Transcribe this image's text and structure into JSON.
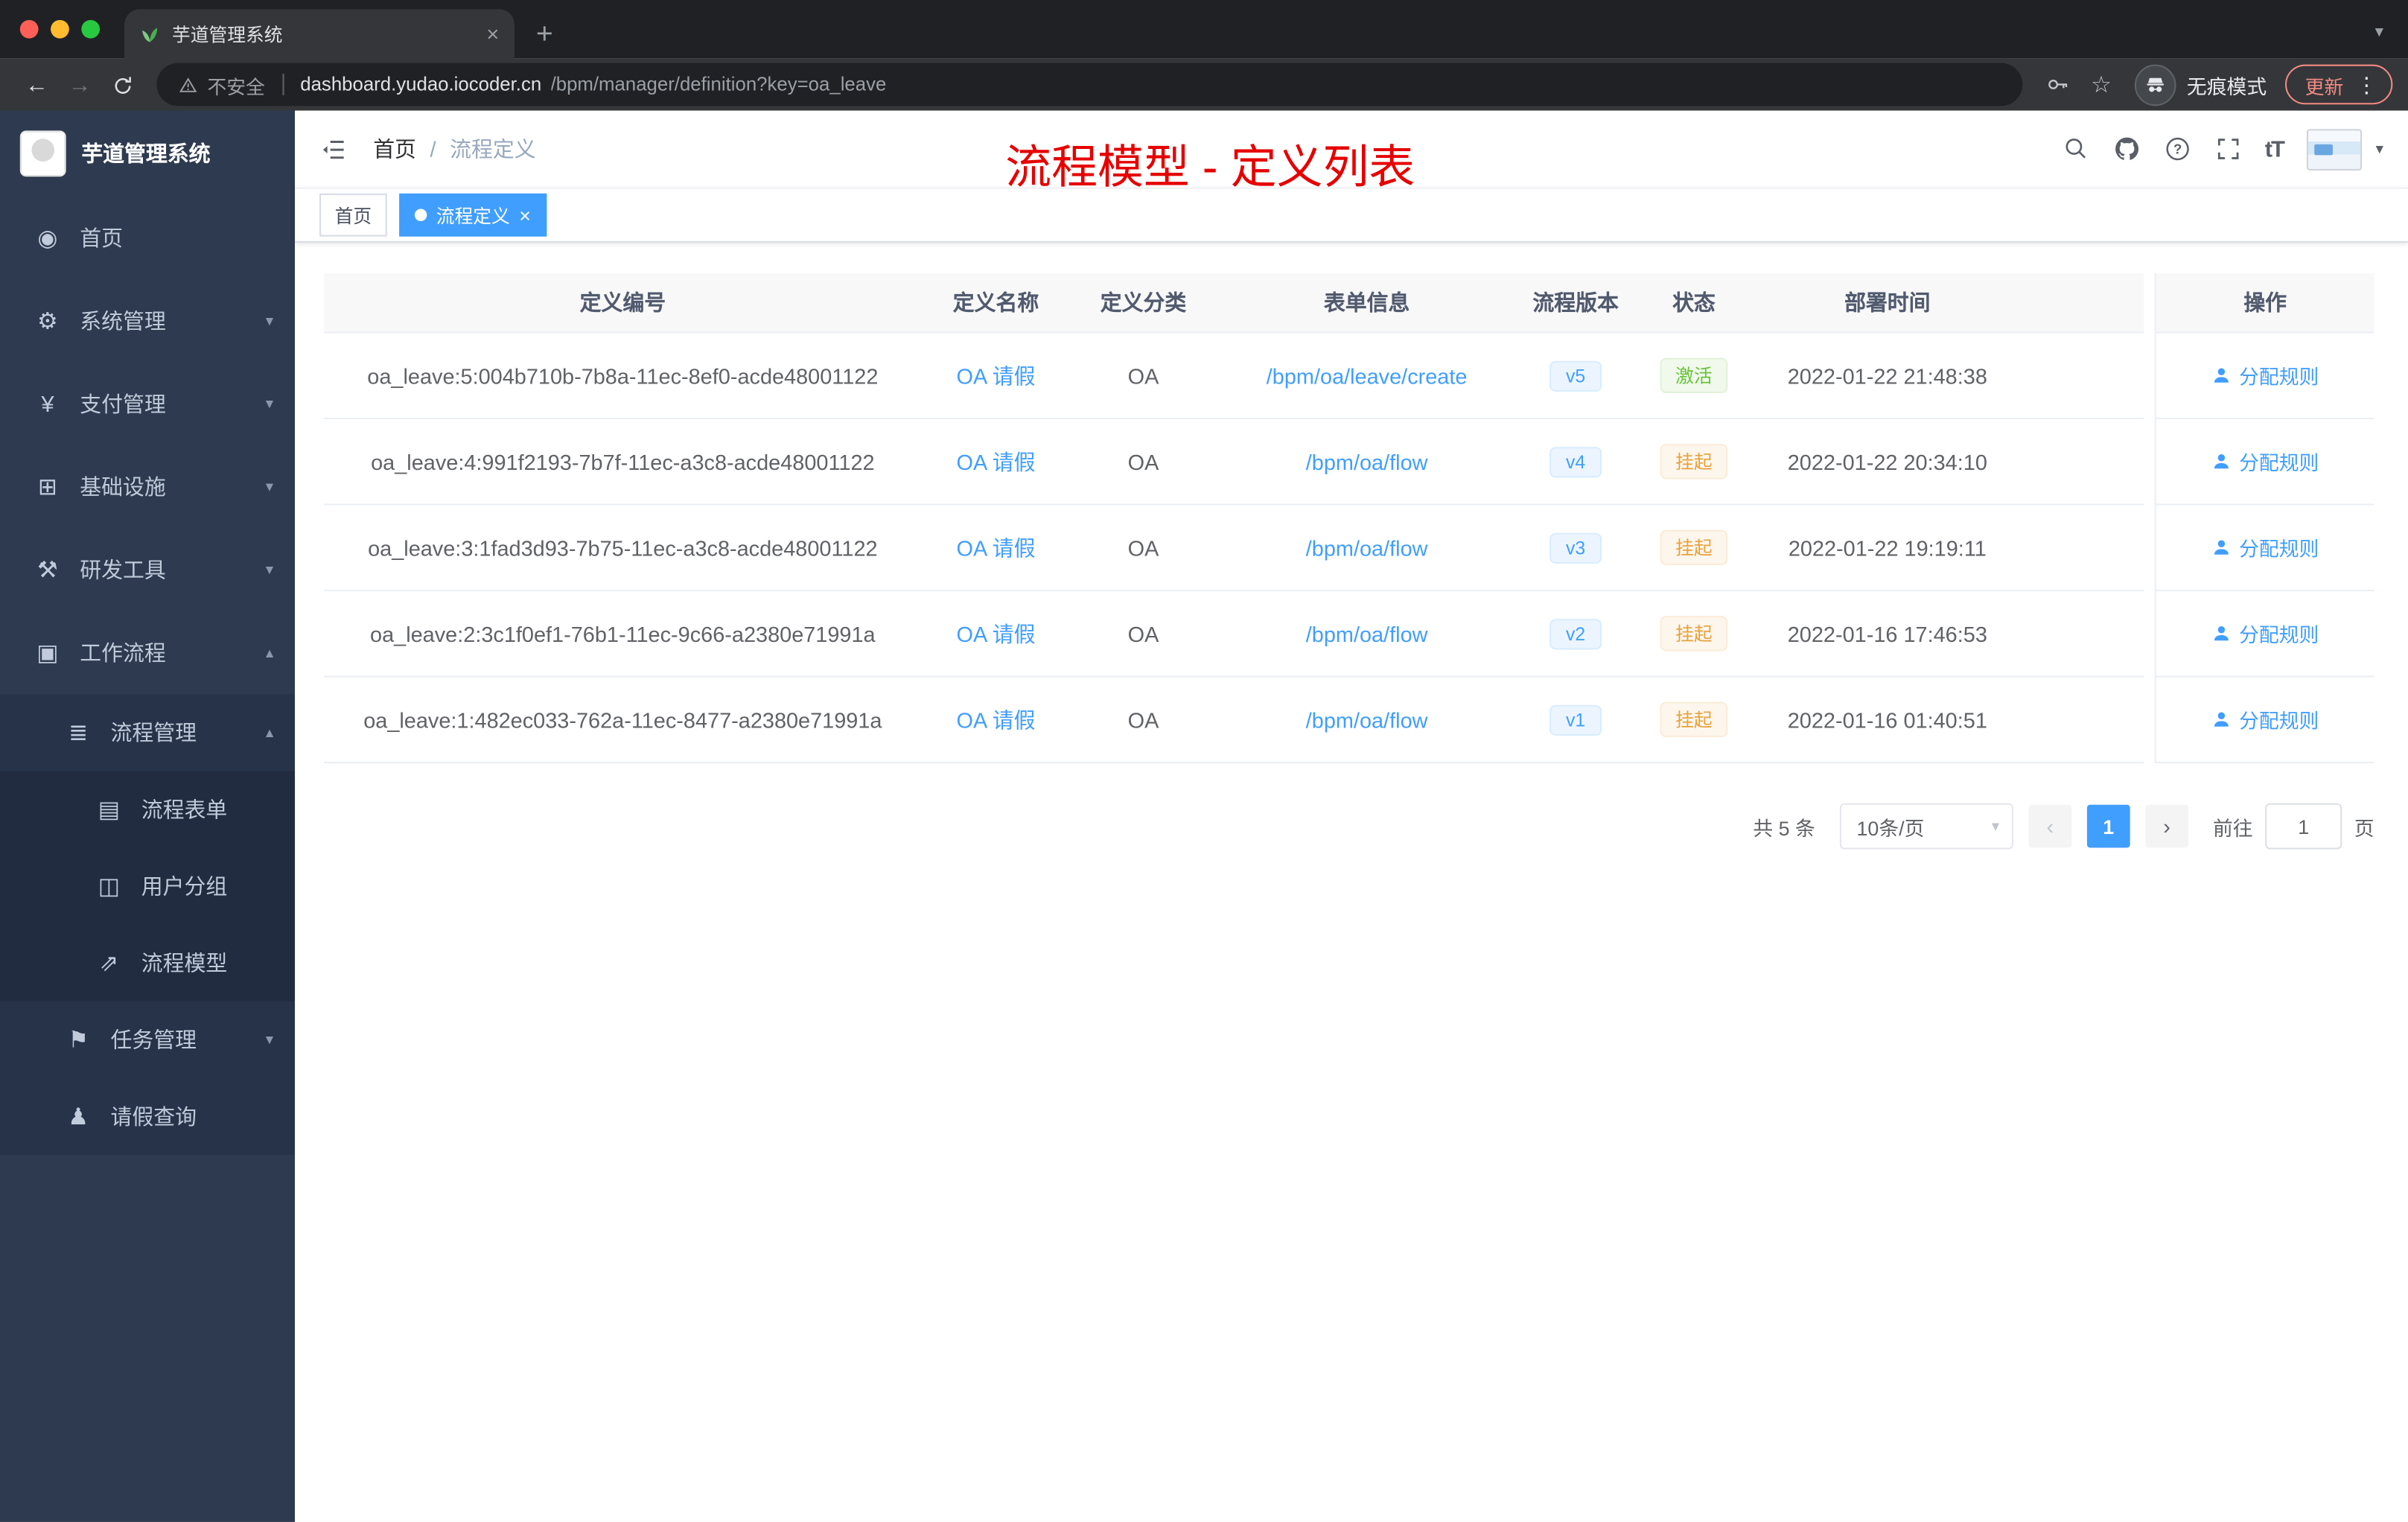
{
  "browser": {
    "tab_title": "芋道管理系统",
    "security_label": "不安全",
    "url_host": "dashboard.yudao.iocoder.cn",
    "url_path": "/bpm/manager/definition?key=oa_leave",
    "incognito_label": "无痕模式",
    "update_label": "更新"
  },
  "colors": {
    "accent": "#409eff",
    "success": "#67c23a",
    "warning": "#e6a23c",
    "annotation_red": "#e60000",
    "sidebar_bg": "#2e3a4f"
  },
  "sidebar": {
    "brand": "芋道管理系统",
    "items": [
      {
        "label": "首页",
        "icon": "dashboard-icon",
        "glyph": "◉",
        "level": "l1",
        "chevron": "none"
      },
      {
        "label": "系统管理",
        "icon": "gear-icon",
        "glyph": "⚙",
        "level": "l1",
        "chevron": "down"
      },
      {
        "label": "支付管理",
        "icon": "payment-icon",
        "glyph": "¥",
        "level": "l1",
        "chevron": "down"
      },
      {
        "label": "基础设施",
        "icon": "infrastructure-icon",
        "glyph": "⊞",
        "level": "l1",
        "chevron": "down"
      },
      {
        "label": "研发工具",
        "icon": "dev-tools-icon",
        "glyph": "⚒",
        "level": "l1",
        "chevron": "down"
      },
      {
        "label": "工作流程",
        "icon": "workflow-icon",
        "glyph": "▣",
        "level": "l1",
        "chevron": "up"
      },
      {
        "label": "流程管理",
        "icon": "process-list-icon",
        "glyph": "≣",
        "level": "l2",
        "chevron": "up"
      },
      {
        "label": "流程表单",
        "icon": "form-icon",
        "glyph": "▤",
        "level": "l3",
        "chevron": "none"
      },
      {
        "label": "用户分组",
        "icon": "user-group-icon",
        "glyph": "◫",
        "level": "l3",
        "chevron": "none"
      },
      {
        "label": "流程模型",
        "icon": "process-model-icon",
        "glyph": "⇗",
        "level": "l3",
        "chevron": "none"
      },
      {
        "label": "任务管理",
        "icon": "task-icon",
        "glyph": "⚑",
        "level": "l2",
        "chevron": "down"
      },
      {
        "label": "请假查询",
        "icon": "leave-query-icon",
        "glyph": "♟",
        "level": "l2",
        "chevron": "none"
      }
    ]
  },
  "header": {
    "breadcrumb_home": "首页",
    "breadcrumb_separator": "/",
    "breadcrumb_current": "流程定义",
    "annotation": "流程模型 - 定义列表",
    "fontsize_icon_text": "tT"
  },
  "tags": [
    {
      "label": "首页",
      "state": "plain"
    },
    {
      "label": "流程定义",
      "state": "active"
    }
  ],
  "table": {
    "columns": [
      "定义编号",
      "定义名称",
      "定义分类",
      "表单信息",
      "流程版本",
      "状态",
      "部署时间",
      "操作"
    ],
    "action_label": "分配规则",
    "rows": [
      {
        "id": "oa_leave:5:004b710b-7b8a-11ec-8ef0-acde48001122",
        "name": "OA 请假",
        "category": "OA",
        "form": "/bpm/oa/leave/create",
        "version": "v5",
        "status": "激活",
        "status_type": "success",
        "deploy_time": "2022-01-22 21:48:38"
      },
      {
        "id": "oa_leave:4:991f2193-7b7f-11ec-a3c8-acde48001122",
        "name": "OA 请假",
        "category": "OA",
        "form": "/bpm/oa/flow",
        "version": "v4",
        "status": "挂起",
        "status_type": "warning",
        "deploy_time": "2022-01-22 20:34:10"
      },
      {
        "id": "oa_leave:3:1fad3d93-7b75-11ec-a3c8-acde48001122",
        "name": "OA 请假",
        "category": "OA",
        "form": "/bpm/oa/flow",
        "version": "v3",
        "status": "挂起",
        "status_type": "warning",
        "deploy_time": "2022-01-22 19:19:11"
      },
      {
        "id": "oa_leave:2:3c1f0ef1-76b1-11ec-9c66-a2380e71991a",
        "name": "OA 请假",
        "category": "OA",
        "form": "/bpm/oa/flow",
        "version": "v2",
        "status": "挂起",
        "status_type": "warning",
        "deploy_time": "2022-01-16 17:46:53"
      },
      {
        "id": "oa_leave:1:482ec033-762a-11ec-8477-a2380e71991a",
        "name": "OA 请假",
        "category": "OA",
        "form": "/bpm/oa/flow",
        "version": "v1",
        "status": "挂起",
        "status_type": "warning",
        "deploy_time": "2022-01-16 01:40:51"
      }
    ]
  },
  "pagination": {
    "total": "共 5 条",
    "page_size": "10条/页",
    "current_page": "1",
    "goto_label": "前往",
    "goto_value": "1",
    "page_unit": "页"
  }
}
